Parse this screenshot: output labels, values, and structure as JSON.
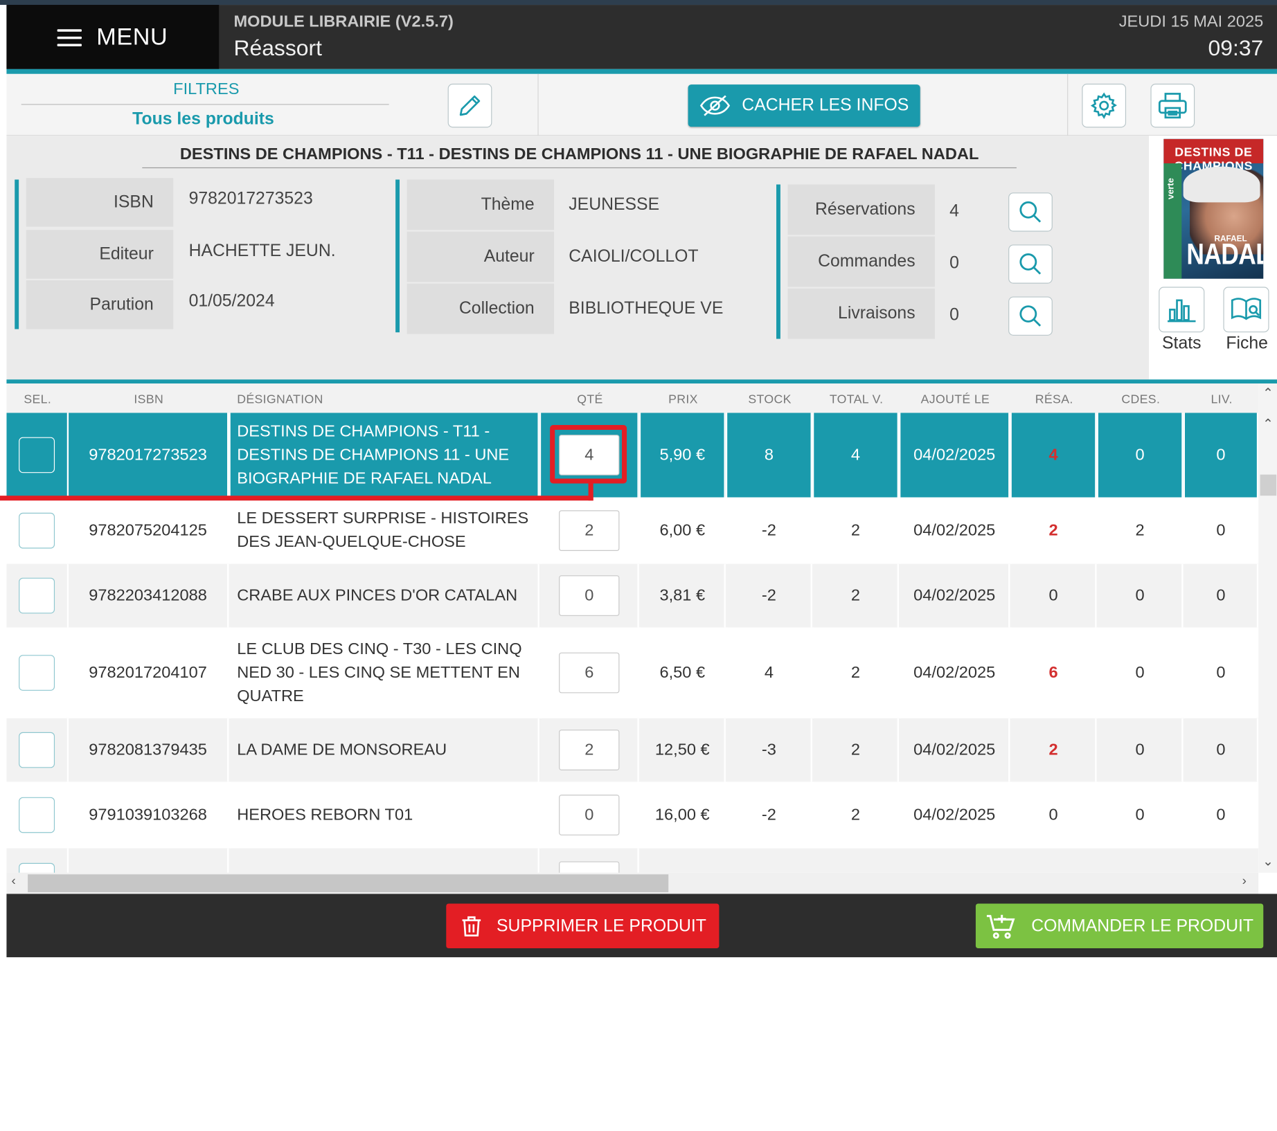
{
  "header": {
    "menu_label": "MENU",
    "module_title": "MODULE LIBRAIRIE (V2.5.7)",
    "page_title": "Réassort",
    "date": "JEUDI 15 MAI 2025",
    "time": "09:37"
  },
  "toolbar": {
    "filters_label": "FILTRES",
    "filters_value": "Tous les produits",
    "hide_info_label": "CACHER LES INFOS"
  },
  "product": {
    "title": "DESTINS DE CHAMPIONS - T11 - DESTINS DE CHAMPIONS 11 - UNE BIOGRAPHIE DE RAFAEL NADAL",
    "fields_left": [
      {
        "label": "ISBN",
        "value": "9782017273523"
      },
      {
        "label": "Editeur",
        "value": "HACHETTE JEUN."
      },
      {
        "label": "Parution",
        "value": "01/05/2024"
      }
    ],
    "fields_mid": [
      {
        "label": "Thème",
        "value": "JEUNESSE"
      },
      {
        "label": "Auteur",
        "value": "CAIOLI/COLLOT"
      },
      {
        "label": "Collection",
        "value": "BIBLIOTHEQUE VE"
      }
    ],
    "fields_right": [
      {
        "label": "Réservations",
        "value": "4"
      },
      {
        "label": "Commandes",
        "value": "0"
      },
      {
        "label": "Livraisons",
        "value": "0"
      }
    ],
    "cover": {
      "series": "DESTINS DE CHAMPIONS",
      "first_name": "RAFAEL",
      "name": "NADAL",
      "spine": "verte"
    },
    "stats_label": "Stats",
    "fiche_label": "Fiche"
  },
  "table": {
    "columns": [
      "SEL.",
      "ISBN",
      "DÉSIGNATION",
      "QTÉ",
      "PRIX",
      "STOCK",
      "TOTAL V.",
      "AJOUTÉ LE",
      "RÉSA.",
      "CDES.",
      "LIV."
    ],
    "rows": [
      {
        "isbn": "9782017273523",
        "designation": "DESTINS DE CHAMPIONS - T11 - DESTINS DE CHAMPIONS 11 - UNE BIOGRAPHIE DE RAFAEL NADAL",
        "qty": "4",
        "prix": "5,90 €",
        "stock": "8",
        "total": "4",
        "date": "04/02/2025",
        "resa": "4",
        "cdes": "0",
        "liv": "0"
      },
      {
        "isbn": "9782075204125",
        "designation": "LE DESSERT SURPRISE - HISTOIRES DES JEAN-QUELQUE-CHOSE",
        "qty": "2",
        "prix": "6,00 €",
        "stock": "-2",
        "total": "2",
        "date": "04/02/2025",
        "resa": "2",
        "cdes": "2",
        "liv": "0"
      },
      {
        "isbn": "9782203412088",
        "designation": "CRABE AUX PINCES D'OR CATALAN",
        "qty": "0",
        "prix": "3,81 €",
        "stock": "-2",
        "total": "2",
        "date": "04/02/2025",
        "resa": "0",
        "cdes": "0",
        "liv": "0"
      },
      {
        "isbn": "9782017204107",
        "designation": "LE CLUB DES CINQ - T30 - LES CINQ NED 30 - LES CINQ SE METTENT EN QUATRE",
        "qty": "6",
        "prix": "6,50 €",
        "stock": "4",
        "total": "2",
        "date": "04/02/2025",
        "resa": "6",
        "cdes": "0",
        "liv": "0"
      },
      {
        "isbn": "9782081379435",
        "designation": "LA DAME DE MONSOREAU",
        "qty": "2",
        "prix": "12,50 €",
        "stock": "-3",
        "total": "2",
        "date": "04/02/2025",
        "resa": "2",
        "cdes": "0",
        "liv": "0"
      },
      {
        "isbn": "9791039103268",
        "designation": "HEROES REBORN T01",
        "qty": "0",
        "prix": "16,00 €",
        "stock": "-2",
        "total": "2",
        "date": "04/02/2025",
        "resa": "0",
        "cdes": "0",
        "liv": "0"
      }
    ]
  },
  "footer": {
    "delete_label": "SUPPRIMER LE PRODUIT",
    "order_label": "COMMANDER LE PRODUIT"
  },
  "colors": {
    "accent": "#1a9aac",
    "danger": "#e31e24",
    "success": "#7cc242",
    "header_bg": "#2d2d2d"
  }
}
